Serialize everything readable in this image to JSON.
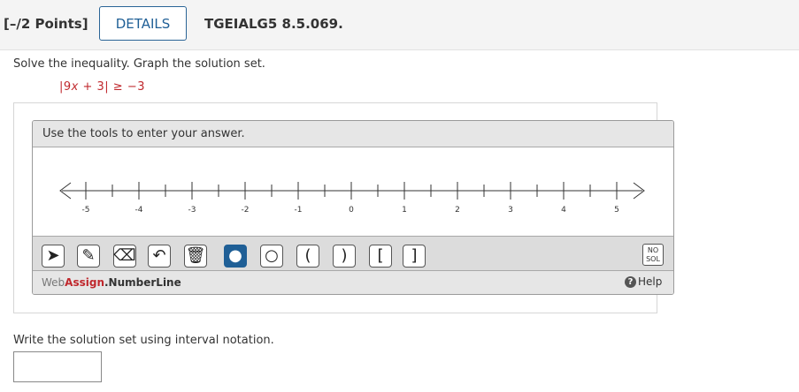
{
  "header": {
    "points": "[–/2 Points]",
    "details_label": "DETAILS",
    "code": "TGEIALG5 8.5.069."
  },
  "question": {
    "prompt": "Solve the inequality. Graph the solution set.",
    "equation_parts": [
      "|9",
      "x",
      " + 3| ≥ −3"
    ]
  },
  "widget": {
    "title": "Use the tools to enter your answer.",
    "ticks": [
      "-5",
      "-4",
      "-3",
      "-2",
      "-1",
      "0",
      "1",
      "2",
      "3",
      "4",
      "5"
    ],
    "tools": [
      {
        "name": "pointer-tool",
        "glyph": "➤",
        "selected": false
      },
      {
        "name": "pencil-tool",
        "glyph": "✎",
        "selected": false
      },
      {
        "name": "eraser-tool",
        "glyph": "⌫",
        "selected": false
      },
      {
        "name": "undo-tool",
        "glyph": "↶",
        "selected": false
      },
      {
        "name": "trash-tool",
        "glyph": "🗑",
        "selected": false
      },
      {
        "name": "closed-dot-tool",
        "glyph": "●",
        "selected": true
      },
      {
        "name": "open-dot-tool",
        "glyph": "○",
        "selected": false
      },
      {
        "name": "open-left-paren-tool",
        "glyph": "(",
        "selected": false
      },
      {
        "name": "open-right-paren-tool",
        "glyph": ")",
        "selected": false
      },
      {
        "name": "left-bracket-tool",
        "glyph": "[",
        "selected": false
      },
      {
        "name": "right-bracket-tool",
        "glyph": "]",
        "selected": false
      }
    ],
    "nosol_line1": "NO",
    "nosol_line2": "SOL",
    "brand_web": "Web",
    "brand_assign": "Assign",
    "brand_rest": ".NumberLine",
    "help_icon": "?",
    "help_label": "Help"
  },
  "answer": {
    "label": "Write the solution set using interval notation.",
    "value": ""
  },
  "colors": {
    "accent": "#1f5f96",
    "red": "#c0282d"
  }
}
